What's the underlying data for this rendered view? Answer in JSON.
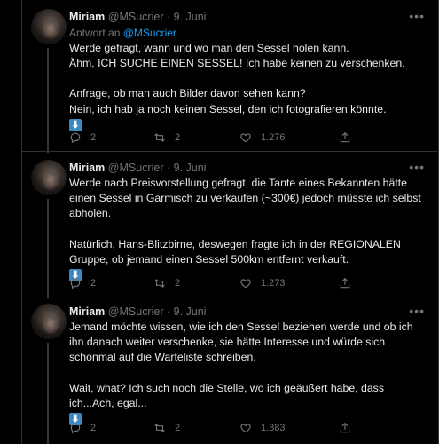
{
  "tweets": [
    {
      "name": "Miriam",
      "handle": "@MSucrier",
      "sep": "·",
      "date": "9. Juni",
      "reply_prefix": "Antwort an",
      "reply_to": "@MSucrier",
      "paragraphs": [
        "Werde gefragt, wann und wo man den Sessel holen kann.\nÄhm, ICH SUCHE EINEN SESSEL! Ich habe keinen zu verschenken.",
        "Anfrage, ob man auch Bilder davon sehen kann?\nNein, ich hab ja noch keinen Sessel, den ich fotografieren könnte."
      ],
      "emoji": "⬇",
      "replies": "2",
      "retweets": "2",
      "likes": "1.276"
    },
    {
      "name": "Miriam",
      "handle": "@MSucrier",
      "sep": "·",
      "date": "9. Juni",
      "paragraphs": [
        "Werde nach Preisvorstellung gefragt, die Tante eines Bekannten hätte einen Sessel in Garmisch zu verkaufen (~300€) jedoch müsste ich selbst abholen.",
        "Natürlich, Hans-Blitzbirne, deswegen fragte ich in der REGIONALEN Gruppe, ob jemand einen Sessel 500km entfernt verkauft."
      ],
      "emoji": "⬇",
      "replies": "2",
      "retweets": "2",
      "likes": "1.273"
    },
    {
      "name": "Miriam",
      "handle": "@MSucrier",
      "sep": "·",
      "date": "9. Juni",
      "paragraphs": [
        "Jemand möchte wissen, wie ich den Sessel beziehen werde und ob ich ihn danach weiter verschenke, sie hätte Interesse und würde sich schonmal auf die Warteliste schreiben.",
        "Wait, what? Ich such noch die Stelle, wo ich geäußert habe, dass ich...Ach, egal..."
      ],
      "emoji": "⬇",
      "replies": "2",
      "retweets": "2",
      "likes": "1.383"
    }
  ],
  "icons": {
    "more": "more-horizontal-icon",
    "reply": "reply-icon",
    "retweet": "retweet-icon",
    "like": "heart-icon",
    "share": "share-icon",
    "emoji": "down-arrow-emoji-icon"
  },
  "colors": {
    "background": "#000000",
    "text": "#e7e9ea",
    "secondary": "#71767b",
    "link": "#1d9bf0",
    "border": "#2f3336",
    "emoji_bg": "#3b88c3"
  }
}
